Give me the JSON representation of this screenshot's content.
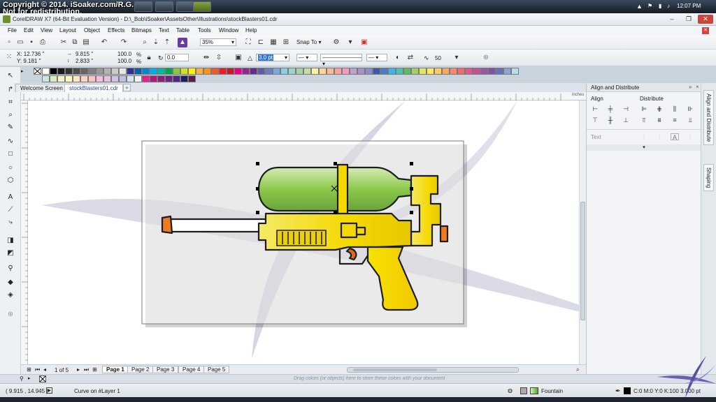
{
  "watermark": {
    "line1": "Copyright © 2014. iSoaker.com/R.G.",
    "line2": "Not for redistribution."
  },
  "taskbar": {
    "time": "12:07 PM"
  },
  "window": {
    "title": "CorelDRAW X7 (64-Bit Evaluation Version) - D:\\_Bob\\iSoaker\\AssetsOther\\Illustrations\\stockBlasters01.cdr"
  },
  "menu": [
    "File",
    "Edit",
    "View",
    "Layout",
    "Object",
    "Effects",
    "Bitmaps",
    "Text",
    "Table",
    "Tools",
    "Window",
    "Help"
  ],
  "toolbar": {
    "zoom": "35%",
    "snap_to": "Snap To"
  },
  "property_bar": {
    "x": "X: 12.736 \"",
    "y": "Y: 9.181 \"",
    "width": "9.815 \"",
    "height": "2.833 \"",
    "scale_x": "100.0",
    "scale_y": "100.0",
    "pct": "%",
    "rotation": "0.0",
    "outline_width": "3.0 pt",
    "smoothing": "50"
  },
  "doc_tabs": [
    "Welcome Screen",
    "stockBlasters01.cdr"
  ],
  "ruler_units": "inches",
  "pages": {
    "counter": "1 of 5",
    "tabs": [
      "Page 1",
      "Page 2",
      "Page 3",
      "Page 4",
      "Page 5"
    ]
  },
  "drag_hint": "Drag colors (or objects) here to store these colors with your document",
  "status": {
    "coords": "( 9.915 , 14.945 )",
    "object": "Curve on #Layer 1",
    "fill": "Fountain",
    "outline": "C:0 M:0 Y:0 K:100  3.000 pt"
  },
  "docker": {
    "title": "Align and Distribute",
    "align": "Align",
    "distribute": "Distribute",
    "text": "Text",
    "tabs": [
      "Align and Distribute",
      "Shaping"
    ]
  },
  "palette_colors": [
    "#ffffff",
    "#000000",
    "#1a1a1a",
    "#333333",
    "#4d4d4d",
    "#666666",
    "#808080",
    "#999999",
    "#b3b3b3",
    "#cccccc",
    "#e6e6e6",
    "#2e3192",
    "#0f5ea8",
    "#0089cf",
    "#00aeef",
    "#00b7a8",
    "#00a651",
    "#8dc63f",
    "#d7df23",
    "#fff200",
    "#fbb040",
    "#f7941d",
    "#f15a29",
    "#ed1c24",
    "#be1e2d",
    "#ec008c",
    "#92278f",
    "#662d91",
    "#5b5ea6",
    "#6b7fc0",
    "#7da7d9",
    "#8ccde6",
    "#9fd3c7",
    "#a7d3a2",
    "#c4df9b",
    "#f9f39a",
    "#fdd39a",
    "#f9b99a",
    "#f5a3a3",
    "#f49ac1",
    "#c6a0cc",
    "#a593c6",
    "#8c8ec9",
    "#3d5aa9",
    "#4d7cc0",
    "#3cb5e6",
    "#4cc2b3",
    "#5dbb63",
    "#a6cf62",
    "#e4e45d",
    "#ffe95a",
    "#ffc964",
    "#fda65e",
    "#f58a6a",
    "#f26b6b",
    "#e0578a",
    "#c5519b",
    "#9f56a2",
    "#7a55a3",
    "#6a6fb8",
    "#8ea3d6",
    "#b9dcef",
    "#c9e8e0",
    "#d7ecc2",
    "#f0f5c2",
    "#fff8bf",
    "#ffe8bf",
    "#fcd6c5",
    "#f9c5c9",
    "#f5bed9",
    "#e2c2e0",
    "#cfc3e2",
    "#bcc0e4",
    "#dbe4f3",
    "#eef6fb",
    "#ed1c8c",
    "#b3177b",
    "#8a1e78",
    "#6e2582",
    "#4b2a85",
    "#1e1e5a",
    "#5c1a4e"
  ],
  "colors": {
    "accent": "#2f6db5",
    "water_tank": "#8cc84a",
    "gun_body": "#f4d800",
    "nozzle": "#f07a24",
    "trigger": "#e2651d"
  }
}
